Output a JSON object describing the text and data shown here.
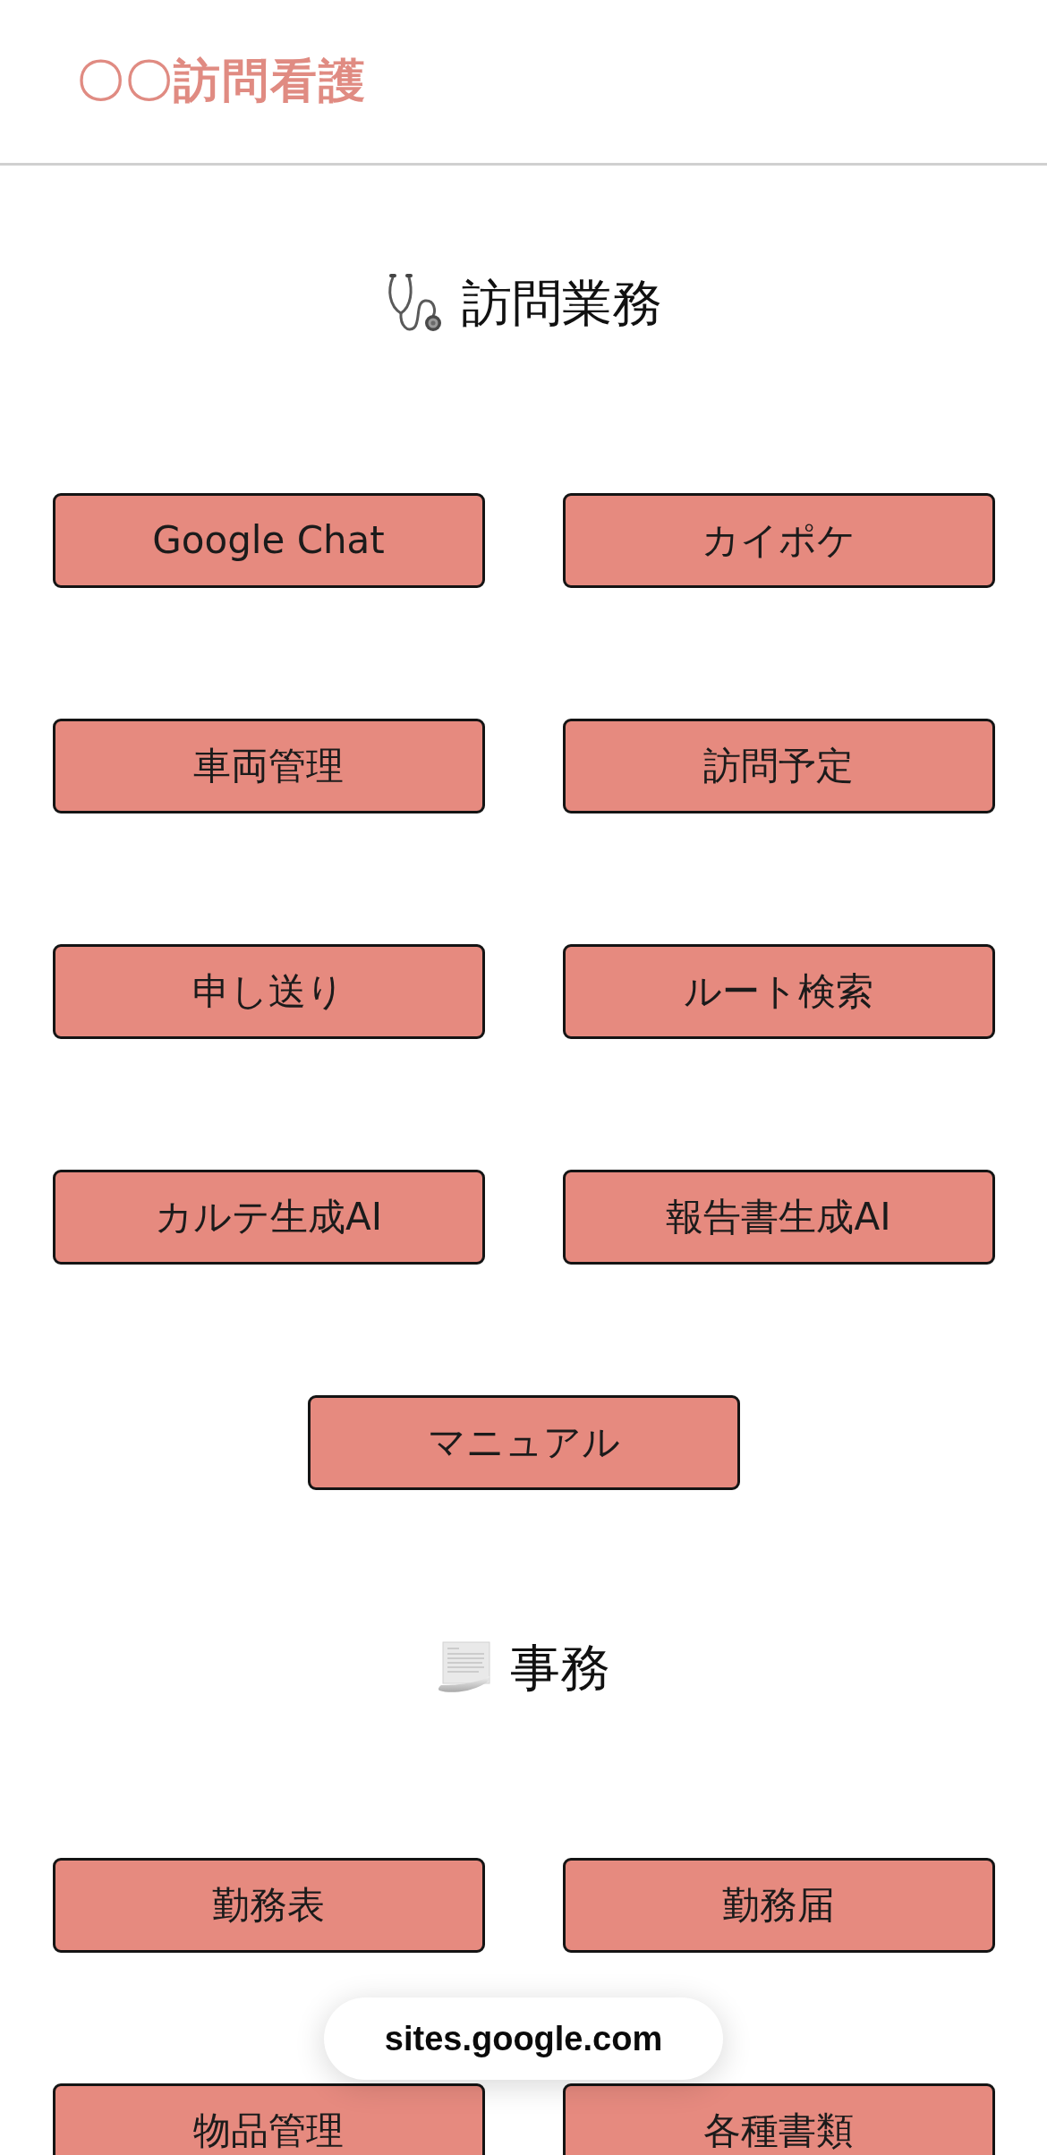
{
  "header": {
    "site_title": "〇〇訪問看護"
  },
  "sections": [
    {
      "heading": "訪問業務",
      "buttons": [
        "Google Chat",
        "カイポケ",
        "車両管理",
        "訪問予定",
        "申し送り",
        "ルート検索",
        "カルテ生成AI",
        "報告書生成AI",
        "マニュアル"
      ]
    },
    {
      "heading": "事務",
      "buttons": [
        "勤務表",
        "勤務届",
        "物品管理",
        "各種書類"
      ]
    }
  ],
  "browser_bar": {
    "url": "sites.google.com"
  }
}
